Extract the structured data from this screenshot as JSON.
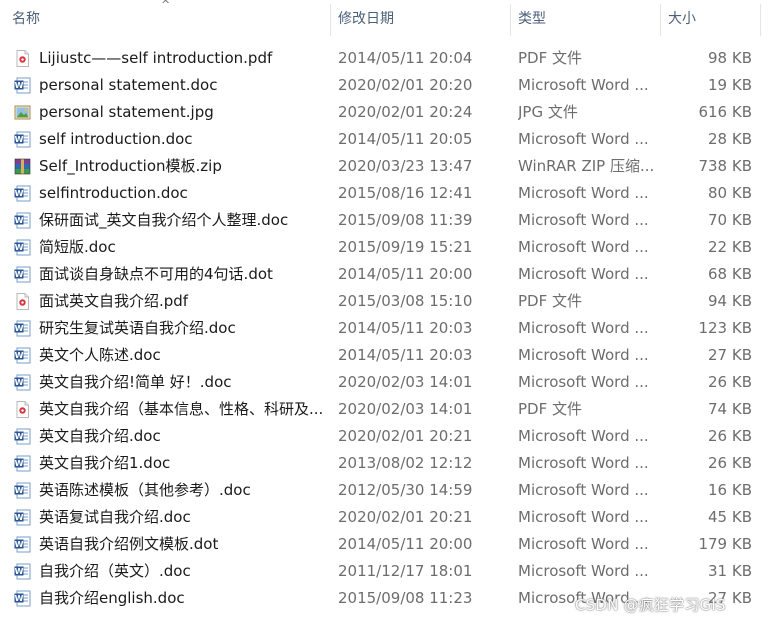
{
  "columns": {
    "name": "名称",
    "date": "修改日期",
    "type": "类型",
    "size": "大小"
  },
  "sort_indicator": "^",
  "files": [
    {
      "name": "Lijiustc——self introduction.pdf",
      "date": "2014/05/11 20:04",
      "type": "PDF 文件",
      "size": "98 KB",
      "icon": "pdf-icon"
    },
    {
      "name": "personal  statement.doc",
      "date": "2020/02/01 20:20",
      "type": "Microsoft Word ...",
      "size": "19 KB",
      "icon": "word-icon"
    },
    {
      "name": "personal statement.jpg",
      "date": "2020/02/01 20:24",
      "type": "JPG 文件",
      "size": "616 KB",
      "icon": "image-icon"
    },
    {
      "name": "self introduction.doc",
      "date": "2014/05/11 20:05",
      "type": "Microsoft Word ...",
      "size": "28 KB",
      "icon": "word-icon"
    },
    {
      "name": "Self_Introduction模板.zip",
      "date": "2020/03/23 13:47",
      "type": "WinRAR ZIP 压缩...",
      "size": "738 KB",
      "icon": "winrar-icon"
    },
    {
      "name": "selfintroduction.doc",
      "date": "2015/08/16 12:41",
      "type": "Microsoft Word ...",
      "size": "80 KB",
      "icon": "word-icon"
    },
    {
      "name": "保研面试_英文自我介绍个人整理.doc",
      "date": "2015/09/08 11:39",
      "type": "Microsoft Word ...",
      "size": "70 KB",
      "icon": "word-icon"
    },
    {
      "name": "简短版.doc",
      "date": "2015/09/19 15:21",
      "type": "Microsoft Word ...",
      "size": "22 KB",
      "icon": "word-icon"
    },
    {
      "name": "面试谈自身缺点不可用的4句话.dot",
      "date": "2014/05/11 20:00",
      "type": "Microsoft Word ...",
      "size": "68 KB",
      "icon": "word-icon"
    },
    {
      "name": "面试英文自我介绍.pdf",
      "date": "2015/03/08 15:10",
      "type": "PDF 文件",
      "size": "94 KB",
      "icon": "pdf-icon"
    },
    {
      "name": "研究生复试英语自我介绍.doc",
      "date": "2014/05/11 20:03",
      "type": "Microsoft Word ...",
      "size": "123 KB",
      "icon": "word-icon"
    },
    {
      "name": "英文个人陈述.doc",
      "date": "2014/05/11 20:03",
      "type": "Microsoft Word ...",
      "size": "27 KB",
      "icon": "word-icon"
    },
    {
      "name": "英文自我介绍!简单 好！.doc",
      "date": "2020/02/03 14:01",
      "type": "Microsoft Word ...",
      "size": "26 KB",
      "icon": "word-icon"
    },
    {
      "name": "英文自我介绍（基本信息、性格、科研及...",
      "date": "2020/02/03 14:01",
      "type": "PDF 文件",
      "size": "74 KB",
      "icon": "pdf-icon"
    },
    {
      "name": "英文自我介绍.doc",
      "date": "2020/02/01 20:21",
      "type": "Microsoft Word ...",
      "size": "26 KB",
      "icon": "word-icon"
    },
    {
      "name": "英文自我介绍1.doc",
      "date": "2013/08/02 12:12",
      "type": "Microsoft Word ...",
      "size": "26 KB",
      "icon": "word-icon"
    },
    {
      "name": "英语陈述模板（其他参考）.doc",
      "date": "2012/05/30 14:59",
      "type": "Microsoft Word ...",
      "size": "16 KB",
      "icon": "word-icon"
    },
    {
      "name": "英语复试自我介绍.doc",
      "date": "2020/02/01 20:21",
      "type": "Microsoft Word ...",
      "size": "45 KB",
      "icon": "word-icon"
    },
    {
      "name": "英语自我介绍例文模板.dot",
      "date": "2014/05/11 20:00",
      "type": "Microsoft Word ...",
      "size": "179 KB",
      "icon": "word-icon"
    },
    {
      "name": "自我介绍（英文）.doc",
      "date": "2011/12/17 18:01",
      "type": "Microsoft Word ...",
      "size": "31 KB",
      "icon": "word-icon"
    },
    {
      "name": "自我介绍english.doc",
      "date": "2015/09/08 11:23",
      "type": "Microsoft Word ...",
      "size": "27 KB",
      "icon": "word-icon"
    }
  ],
  "watermark": "CSDN @疯狂学习GIS",
  "colors": {
    "header_text": "#4c607a",
    "secondary_text": "#6d6d6d",
    "word_blue": "#2b5797",
    "pdf_red": "#d9363e"
  }
}
